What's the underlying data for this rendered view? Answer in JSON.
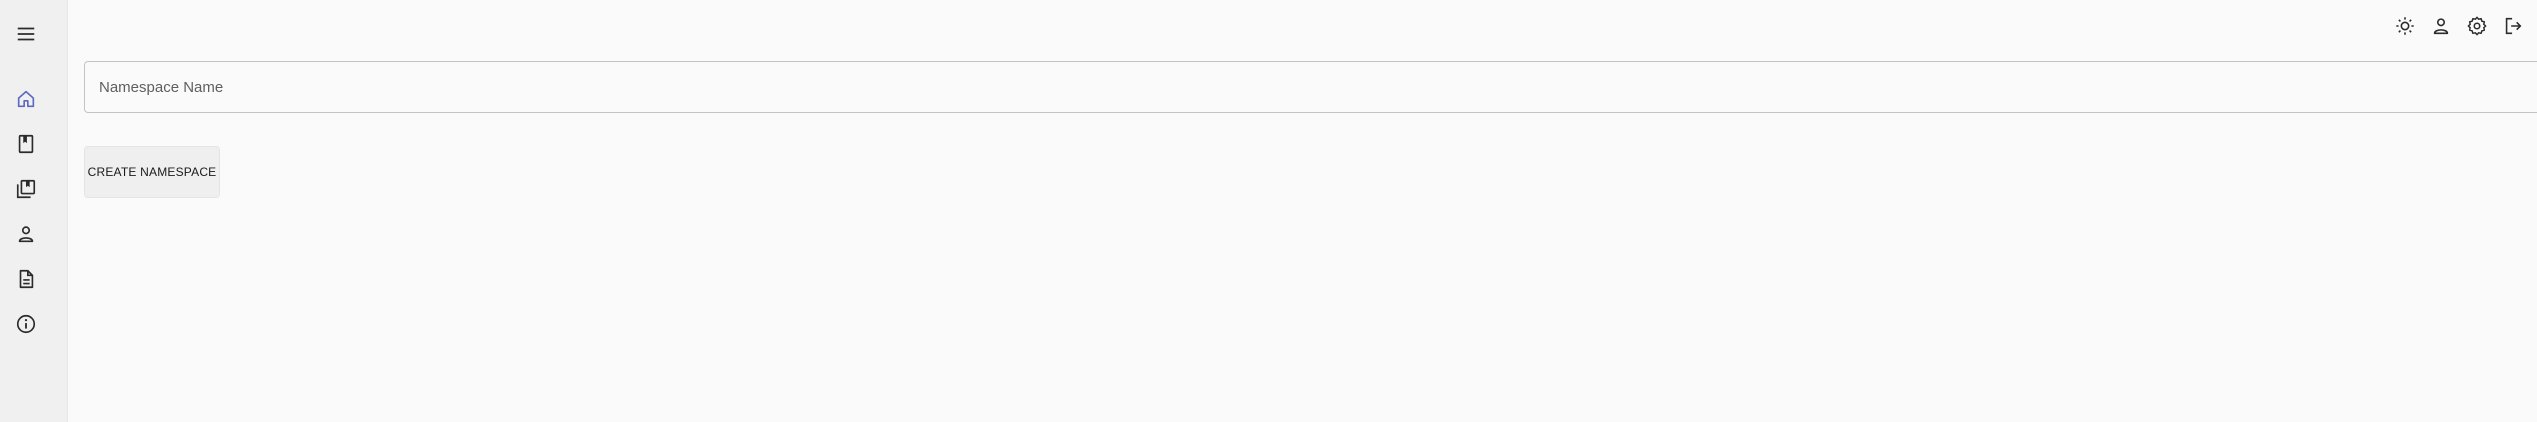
{
  "sidebar": {
    "items": [
      {
        "name": "menu",
        "icon": "hamburger-menu-icon",
        "active": false
      },
      {
        "name": "home",
        "icon": "home-icon",
        "active": true
      },
      {
        "name": "book",
        "icon": "book-icon",
        "active": false
      },
      {
        "name": "library",
        "icon": "library-books-icon",
        "active": false
      },
      {
        "name": "user",
        "icon": "person-icon",
        "active": false
      },
      {
        "name": "document",
        "icon": "document-icon",
        "active": false
      },
      {
        "name": "info",
        "icon": "info-icon",
        "active": false
      }
    ]
  },
  "topbar": {
    "icons": [
      "light-mode-sun-icon",
      "account-person-icon",
      "settings-gear-icon",
      "logout-icon"
    ]
  },
  "form": {
    "namespace_placeholder": "Namespace Name",
    "namespace_value": "",
    "create_label": "CREATE NAMESPACE"
  },
  "colors": {
    "accent": "#5c6bc0",
    "icon": "#2b2b2b",
    "sidebar_bg": "#f1f0f1",
    "page_bg": "#fafafa"
  }
}
